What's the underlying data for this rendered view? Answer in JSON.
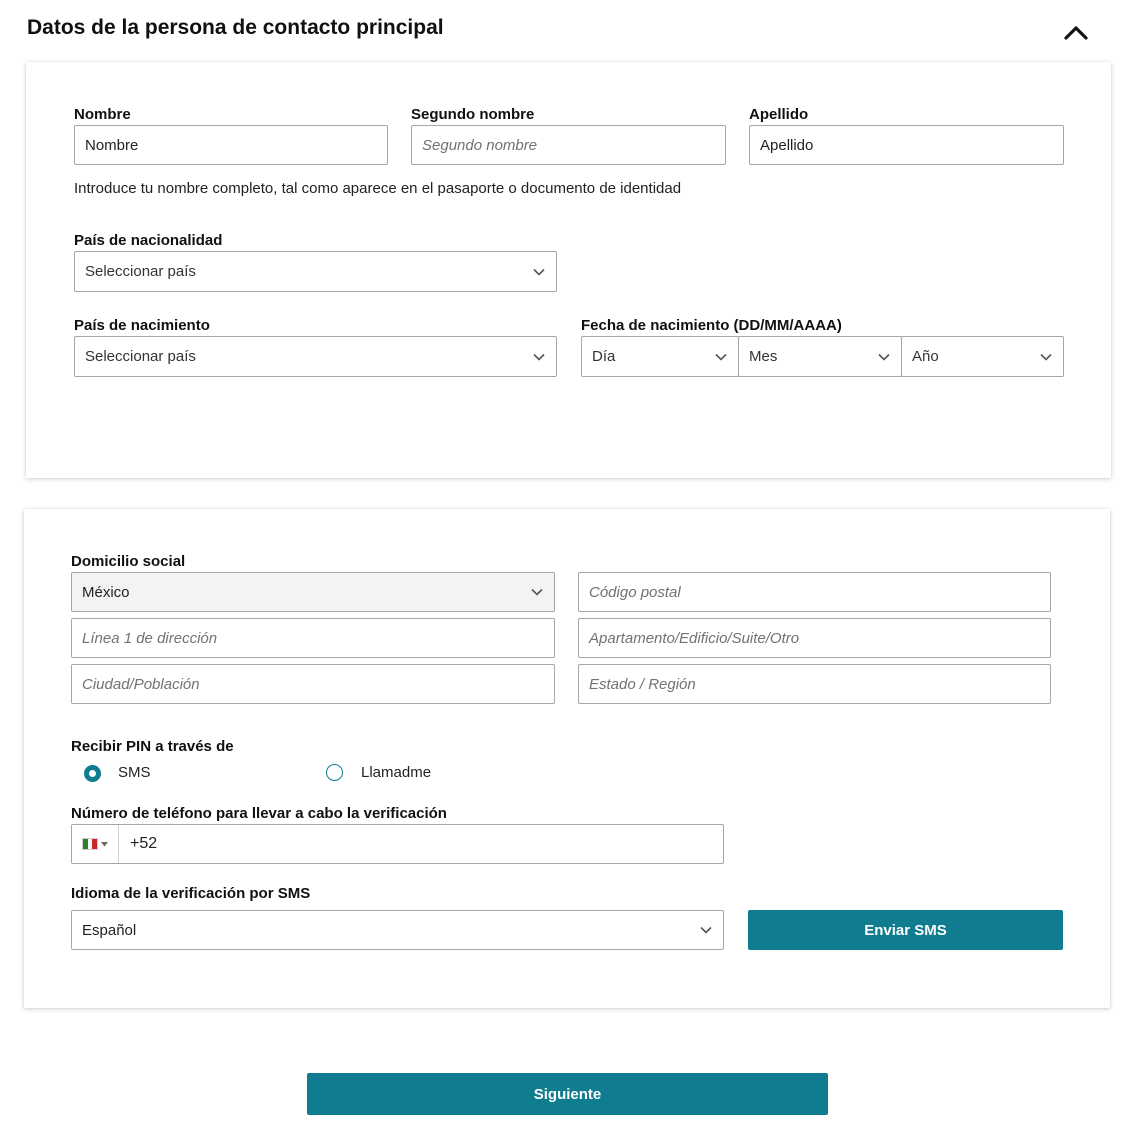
{
  "section": {
    "title": "Datos de la persona de contacto principal"
  },
  "name": {
    "first_label": "Nombre",
    "first_value": "Nombre",
    "middle_label": "Segundo nombre",
    "middle_placeholder": "Segundo nombre",
    "last_label": "Apellido",
    "last_value": "Apellido",
    "hint": "Introduce tu nombre completo, tal como aparece en el pasaporte o documento de identidad"
  },
  "nationality": {
    "label": "País de nacionalidad",
    "value": "Seleccionar país"
  },
  "birth_country": {
    "label": "País de nacimiento",
    "value": "Seleccionar país"
  },
  "birth_date": {
    "label": "Fecha de nacimiento (DD/MM/AAAA)",
    "day": "Día",
    "month": "Mes",
    "year": "Año"
  },
  "address": {
    "label": "Domicilio social",
    "country": "México",
    "postal_code_placeholder": "Código postal",
    "line1_placeholder": "Línea 1 de dirección",
    "line2_placeholder": "Apartamento/Edificio/Suite/Otro",
    "city_placeholder": "Ciudad/Población",
    "state_placeholder": "Estado / Región"
  },
  "pin": {
    "label": "Recibir PIN a través de",
    "option_sms": "SMS",
    "option_call": "Llamadme",
    "selected": "SMS"
  },
  "phone": {
    "label": "Número de teléfono para llevar a cabo la verificación",
    "value": "+52",
    "flag_icon": "mexico-flag-icon"
  },
  "sms_language": {
    "label": "Idioma de la verificación por SMS",
    "value": "Español",
    "send_button": "Enviar SMS"
  },
  "footer": {
    "next_button": "Siguiente"
  },
  "colors": {
    "accent": "#0f7c90",
    "border": "#a6a6a6",
    "placeholder": "#6f7373"
  }
}
